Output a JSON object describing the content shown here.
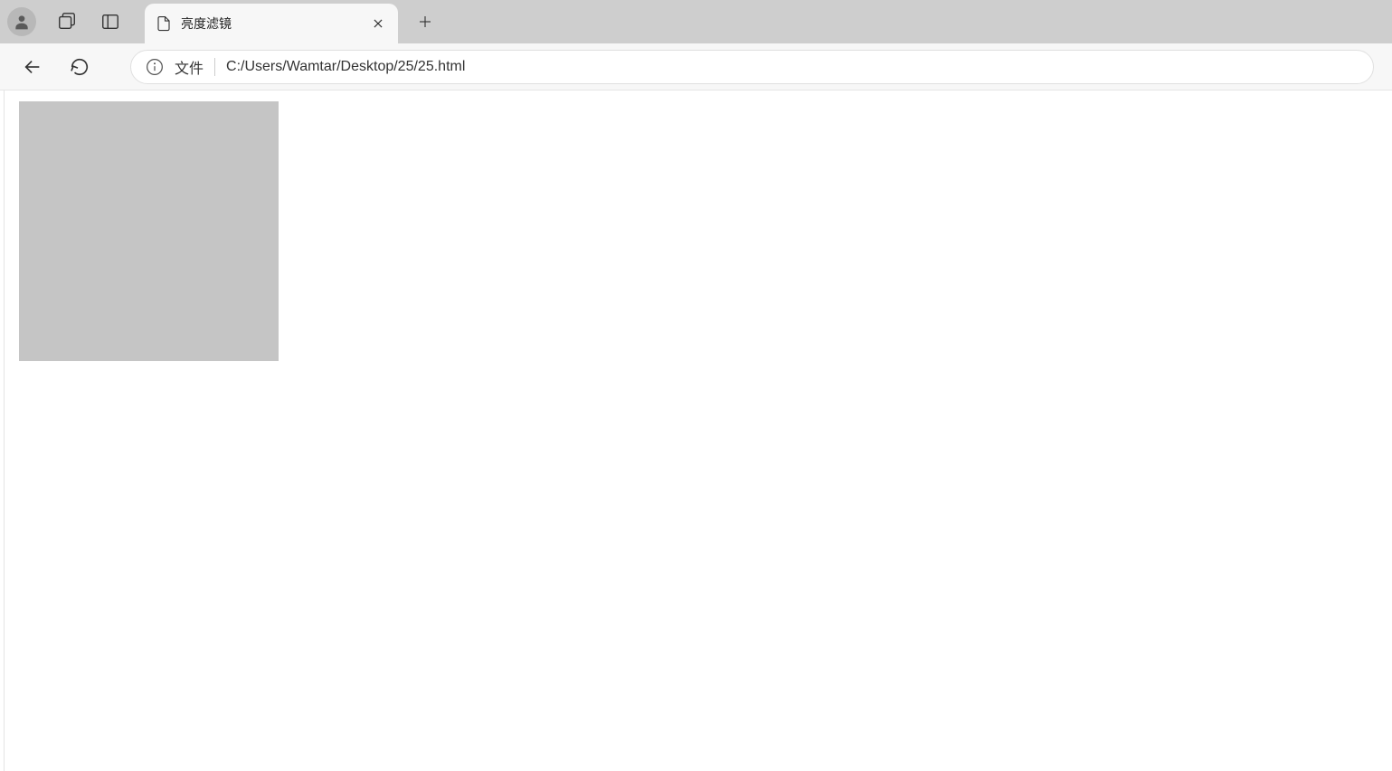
{
  "tab": {
    "title": "亮度滤镜"
  },
  "address": {
    "protocol": "文件",
    "url": "C:/Users/Wamtar/Desktop/25/25.html"
  }
}
